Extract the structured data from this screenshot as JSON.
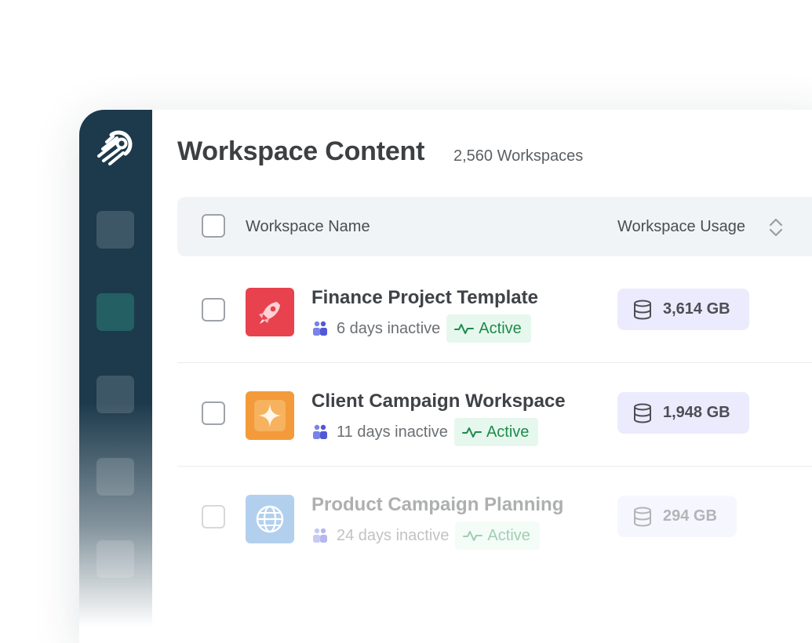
{
  "header": {
    "title": "Workspace Content",
    "count": "2,560 Workspaces"
  },
  "table": {
    "columns": {
      "name": "Workspace Name",
      "usage": "Workspace Usage"
    },
    "rows": [
      {
        "name": "Finance Project Template",
        "inactive": "6 days inactive",
        "status": "Active",
        "usage": "3,614 GB",
        "icon": "rocket-icon",
        "icon_color": "#e8424f"
      },
      {
        "name": "Client Campaign Workspace",
        "inactive": "11 days inactive",
        "status": "Active",
        "usage": "1,948 GB",
        "icon": "sparkle-icon",
        "icon_color": "#f39a3a"
      },
      {
        "name": "Product Campaign Planning",
        "inactive": "24 days inactive",
        "status": "Active",
        "usage": "294 GB",
        "icon": "globe-icon",
        "icon_color": "#4a90d9"
      }
    ]
  },
  "colors": {
    "sidebar": "#1d3a4c",
    "active_nav": "#235f63",
    "active_badge_bg": "#e6f8ee",
    "active_badge_text": "#1f8a4c",
    "usage_badge_bg": "#ecebfd"
  }
}
